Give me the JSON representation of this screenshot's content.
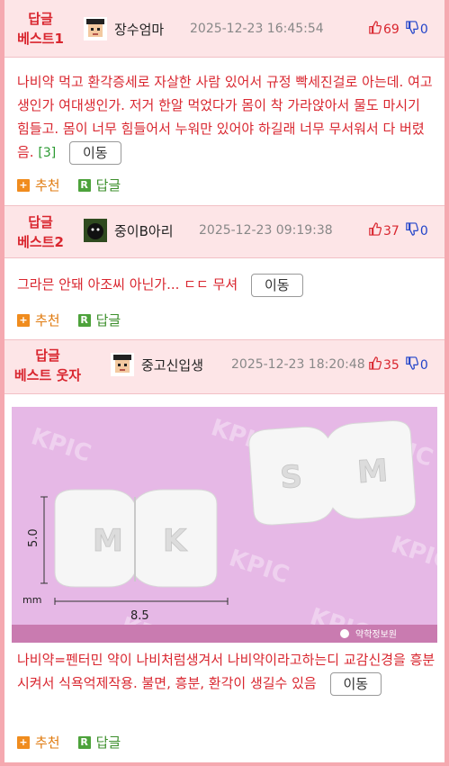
{
  "posts": [
    {
      "rank_line1": "답글",
      "rank_line2": "베스트1",
      "nickname": "장수엄마",
      "datetime": "2025-12-23 16:45:54",
      "upvotes": "69",
      "downvotes": "0",
      "body": "나비약 먹고 환각증세로 자살한 사람 있어서 규정 빡세진걸로 아는데. 여고생인가 여대생인가. 저거 한알 먹었다가 몸이 착 가라앉아서 물도 마시기 힘들고. 몸이 너무 힘들어서 누워만 있어야 하길래 너무 무서워서 다 버렸음.",
      "reply_count": "[3]",
      "move_label": "이동",
      "recommend_label": "추천",
      "reply_label": "답글"
    },
    {
      "rank_line1": "답글",
      "rank_line2": "베스트2",
      "nickname": "중이B아리",
      "datetime": "2025-12-23 09:19:38",
      "upvotes": "37",
      "downvotes": "0",
      "body": "그라믄 안돼 아조씨 아닌가... ㄷㄷ 무셔",
      "move_label": "이동",
      "recommend_label": "추천",
      "reply_label": "답글"
    },
    {
      "rank_line1": "답글",
      "rank_line2": "베스트 웃자",
      "nickname": "중고신입생",
      "datetime": "2025-12-23 18:20:48",
      "upvotes": "35",
      "downvotes": "0",
      "body": "나비약=펜터민 약이 나비처럼생겨서 나비약이라고하는디 교감신경을 흥분시켜서 식욕억제작용. 불면, 흥분, 환각이 생길수 있음",
      "move_label": "이동",
      "recommend_label": "추천",
      "reply_label": "답글",
      "image": {
        "watermark": "KPIC",
        "pill_left_text": "M K",
        "pill_right_text": "S M",
        "dim_height": "5.0",
        "dim_unit": "mm",
        "dim_width": "8.5",
        "credit": "약학정보원"
      }
    }
  ],
  "colors": {
    "accent_red": "#d9262f",
    "header_bg": "#fde5e7",
    "frame_pink": "#f5a9b0",
    "down_blue": "#2143c9",
    "image_bg": "#e6b8e6"
  }
}
